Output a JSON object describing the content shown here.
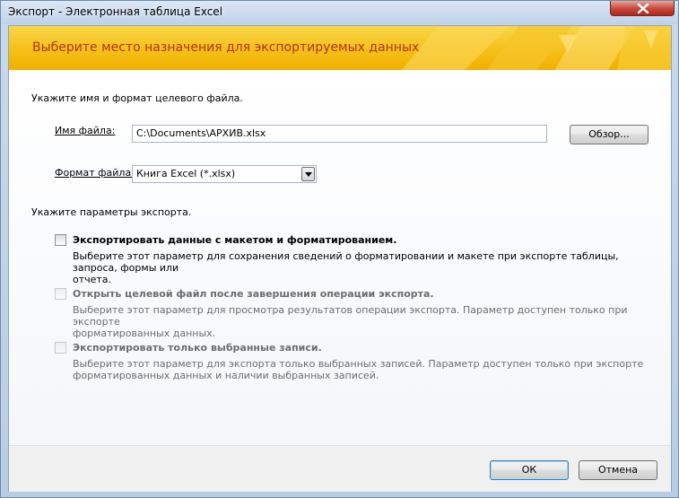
{
  "window": {
    "title": "Экспорт - Электронная таблица Excel"
  },
  "banner": {
    "title": "Выберите место назначения для экспортируемых данных"
  },
  "file_section": {
    "heading": "Укажите имя и формат целевого файла.",
    "file_name_label": "Имя файла:",
    "file_name_value": "C:\\Documents\\АРХИВ.xlsx",
    "browse_label": "Обзор...",
    "format_label": "Формат файла:",
    "format_value": "Книга Excel (*.xlsx)"
  },
  "options_section": {
    "heading": "Укажите параметры экспорта.",
    "options": [
      {
        "label": "Экспортировать данные с макетом и форматированием.",
        "desc_line1": "Выберите этот параметр для сохранения сведений о форматировании и макете при экспорте таблицы, запроса, формы или",
        "desc_line2": "отчета.",
        "checked": false,
        "enabled": true
      },
      {
        "label": "Открыть целевой файл после завершения операции экспорта.",
        "desc_line1": "Выберите этот параметр для просмотра результатов операции экспорта. Параметр доступен только при экспорте",
        "desc_line2": "форматированных данных.",
        "checked": false,
        "enabled": false
      },
      {
        "label": "Экспортировать только выбранные записи.",
        "desc_line1": "Выберите этот параметр для экспорта только выбранных записей. Параметр доступен только при экспорте",
        "desc_line2": "форматированных данных и наличии выбранных записей.",
        "checked": false,
        "enabled": false
      }
    ]
  },
  "footer": {
    "ok_label": "ОК",
    "cancel_label": "Отмена"
  },
  "colors": {
    "banner_title": "#b0341a",
    "banner_bg": "#f5c21b",
    "close_button": "#c8463a"
  },
  "icons": {
    "close": "close-icon",
    "dropdown": "chevron-down-icon"
  }
}
